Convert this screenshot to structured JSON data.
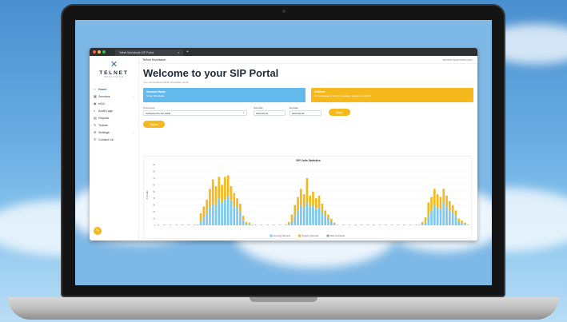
{
  "browser": {
    "tab_title": "Telnet Worldwide SIP Portal",
    "tab_close": "×",
    "new_tab": "+"
  },
  "brand": {
    "name": "TELNET",
    "sub": "WORLDWIDE"
  },
  "sidebar": {
    "items": [
      {
        "label": "Home",
        "icon": "home-icon",
        "glyph": "⌂",
        "active": true,
        "caret": ""
      },
      {
        "label": "Services",
        "icon": "grid-icon",
        "glyph": "▦",
        "active": false,
        "caret": "⌄"
      },
      {
        "label": "e911",
        "icon": "alert-icon",
        "glyph": "◉",
        "active": false,
        "caret": ""
      },
      {
        "label": "Audit Logs",
        "icon": "search-icon",
        "glyph": "⌕",
        "active": false,
        "caret": ""
      },
      {
        "label": "Reports",
        "icon": "document-icon",
        "glyph": "▤",
        "active": false,
        "caret": ""
      },
      {
        "label": "Tickets",
        "icon": "pencil-icon",
        "glyph": "✎",
        "active": false,
        "caret": ""
      },
      {
        "label": "Settings",
        "icon": "settings-icon",
        "glyph": "⚙",
        "active": false,
        "caret": "⌄"
      },
      {
        "label": "Contact Us",
        "icon": "phone-icon",
        "glyph": "✆",
        "active": false,
        "caret": ""
      }
    ]
  },
  "topbar": {
    "title": "TelNet Worldwide",
    "user": "SPROOUTEARTWW.COM ⌄"
  },
  "page": {
    "title": "Welcome to your SIP Portal",
    "subtitle": "Your personalized TelNet Worldwide portal."
  },
  "cards": {
    "account_title": "Account Name",
    "account_value": "Telnet Worldwide",
    "address_title": "Address",
    "address_value": "31700 Research Park Dr, Madison Heights, MI 48071"
  },
  "filters": {
    "trunk_label": "Trunk Group",
    "trunk_value": "TelNetDevTrunk2-SIPD",
    "start_label": "Start Date",
    "start_value": "2020-06-22",
    "end_label": "End Date",
    "end_value": "2020-06-25",
    "apply_label": "Apply",
    "export_label": "Export"
  },
  "colors": {
    "incoming": "#7ec8ee",
    "outgoing": "#f6b91d",
    "accent": "#2b6cb0"
  },
  "chart_data": {
    "type": "bar",
    "title": "SIP Calls Statistics",
    "ylabel": "# of Calls",
    "ylim": [
      0,
      90
    ],
    "yticks": [
      0,
      10,
      20,
      30,
      40,
      50,
      60,
      70,
      80,
      90
    ],
    "stacked": true,
    "categories": [
      "",
      "",
      "",
      "",
      "",
      "",
      "",
      "",
      "",
      "",
      "",
      "",
      "",
      "",
      "",
      "",
      "",
      "",
      "",
      "",
      "",
      "",
      "",
      "",
      "",
      "",
      "",
      "",
      "",
      "",
      "",
      "",
      "",
      "",
      "",
      "",
      "",
      "",
      "",
      "",
      "",
      "",
      "",
      "",
      "",
      "",
      "",
      "",
      "",
      "",
      "",
      "",
      "",
      "",
      "",
      "",
      "",
      "",
      "",
      "",
      "",
      "",
      "",
      "",
      "",
      "",
      "",
      "",
      "",
      "",
      "",
      "",
      "",
      "",
      ""
    ],
    "series": [
      {
        "name": "Incoming Attempts",
        "color": "#7ec8ee",
        "values": [
          0,
          0,
          0,
          0,
          0,
          0,
          0,
          0,
          0,
          0,
          0,
          0,
          0,
          0,
          6,
          12,
          18,
          26,
          32,
          30,
          40,
          34,
          38,
          44,
          36,
          28,
          26,
          20,
          8,
          2,
          2,
          0,
          0,
          0,
          0,
          0,
          0,
          0,
          0,
          0,
          0,
          0,
          0,
          2,
          6,
          14,
          22,
          30,
          26,
          34,
          28,
          30,
          24,
          26,
          20,
          14,
          10,
          6,
          2,
          0,
          0,
          0,
          0,
          0,
          0,
          0,
          0,
          0,
          0,
          0,
          0,
          0,
          0,
          0,
          0,
          0,
          0,
          0,
          0,
          0,
          0,
          0,
          0,
          0,
          0,
          0,
          0,
          2,
          4,
          14,
          22,
          30,
          26,
          24,
          34,
          28,
          22,
          20,
          14,
          6,
          4,
          2,
          0
        ]
      },
      {
        "name": "Outgoing Attempts",
        "color": "#f6b91d",
        "values": [
          1,
          0,
          1,
          0,
          1,
          0,
          1,
          0,
          1,
          0,
          1,
          0,
          1,
          1,
          12,
          16,
          20,
          28,
          36,
          28,
          32,
          26,
          34,
          30,
          22,
          20,
          14,
          12,
          6,
          3,
          2,
          1,
          1,
          0,
          1,
          0,
          1,
          0,
          1,
          0,
          1,
          0,
          1,
          3,
          10,
          16,
          20,
          24,
          20,
          36,
          16,
          20,
          16,
          18,
          12,
          8,
          6,
          4,
          2,
          1,
          0,
          1,
          0,
          1,
          0,
          1,
          0,
          1,
          0,
          1,
          0,
          1,
          0,
          1,
          0,
          1,
          0,
          1,
          0,
          1,
          0,
          1,
          0,
          1,
          0,
          1,
          1,
          3,
          8,
          20,
          20,
          24,
          20,
          18,
          20,
          16,
          14,
          10,
          8,
          4,
          3,
          2,
          1
        ]
      }
    ],
    "legend": [
      "Incoming Attempts",
      "Outgoing Attempts",
      "Total Completed"
    ],
    "legend_position": "bottom"
  }
}
